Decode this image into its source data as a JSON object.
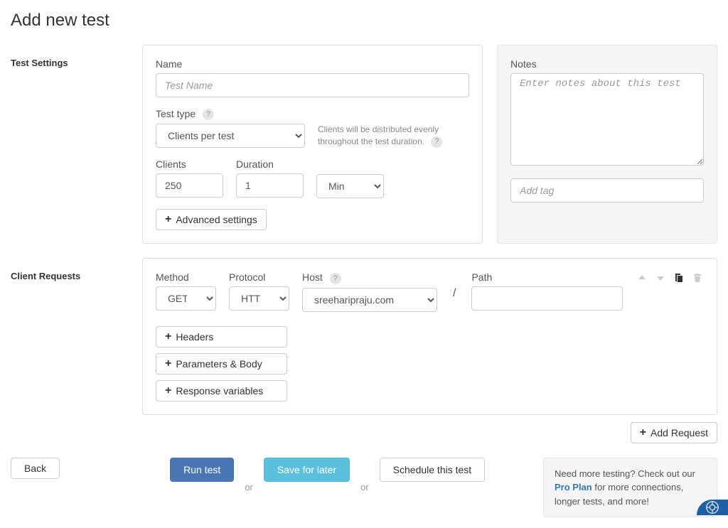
{
  "page_title": "Add new test",
  "sections": {
    "test_settings": "Test Settings",
    "client_requests": "Client Requests"
  },
  "test_settings": {
    "name_label": "Name",
    "name_placeholder": "Test Name",
    "name_value": "",
    "test_type_label": "Test type",
    "test_type_value": "Clients per test",
    "test_type_help": "Clients will be distributed evenly throughout the test duration.",
    "clients_label": "Clients",
    "clients_value": "250",
    "duration_label": "Duration",
    "duration_value": "1",
    "duration_unit": "Min",
    "advanced_settings": "Advanced settings"
  },
  "notes": {
    "label": "Notes",
    "placeholder": "Enter notes about this test",
    "value": "",
    "tag_placeholder": "Add tag",
    "tag_value": ""
  },
  "request": {
    "method_label": "Method",
    "method_value": "GET",
    "protocol_label": "Protocol",
    "protocol_value": "HTTP",
    "host_label": "Host",
    "host_value": "sreeharipraju.com",
    "path_label": "Path",
    "path_value": "",
    "headers_btn": "Headers",
    "params_btn": "Parameters & Body",
    "response_btn": "Response variables"
  },
  "buttons": {
    "add_request": "Add Request",
    "back": "Back",
    "run_test": "Run test",
    "save_for_later": "Save for later",
    "schedule": "Schedule this test",
    "or": "or"
  },
  "promo": {
    "text_before": "Need more testing? Check out our ",
    "link": "Pro Plan",
    "text_after": " for more connections, longer tests, and more!"
  }
}
